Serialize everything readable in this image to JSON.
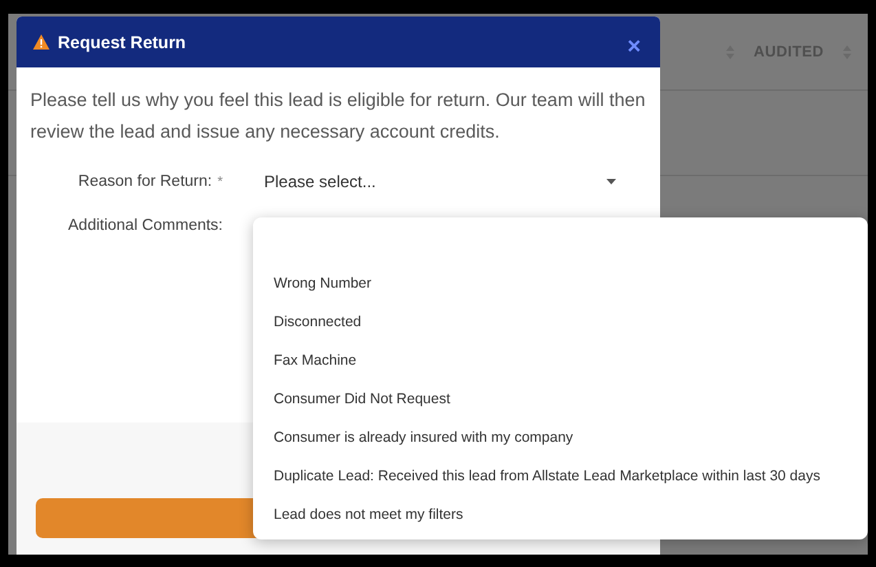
{
  "background_table": {
    "columns": [
      {},
      {
        "label": "AUDITED"
      }
    ]
  },
  "modal": {
    "title": "Request Return",
    "close": "×",
    "description": "Please tell us why you feel this lead is eligible for return. Our team will then review the lead and issue any necessary account credits.",
    "fields": [
      {
        "kind": "select",
        "label": "Reason for Return:",
        "required": true,
        "required_mark": "*",
        "value": "Please select..."
      },
      {
        "kind": "textarea",
        "label": "Additional Comments:",
        "required": false
      }
    ]
  },
  "dropdown": {
    "options": [
      {
        "kind": "blank"
      },
      {
        "label": "Wrong Number"
      },
      {
        "label": "Disconnected"
      },
      {
        "label": "Fax Machine"
      },
      {
        "label": "Consumer Did Not Request"
      },
      {
        "label": "Consumer is already insured with my company"
      },
      {
        "label": "Duplicate Lead: Received this lead from Allstate Lead Marketplace within last 30 days"
      },
      {
        "label": "Lead does not meet my filters"
      }
    ]
  }
}
